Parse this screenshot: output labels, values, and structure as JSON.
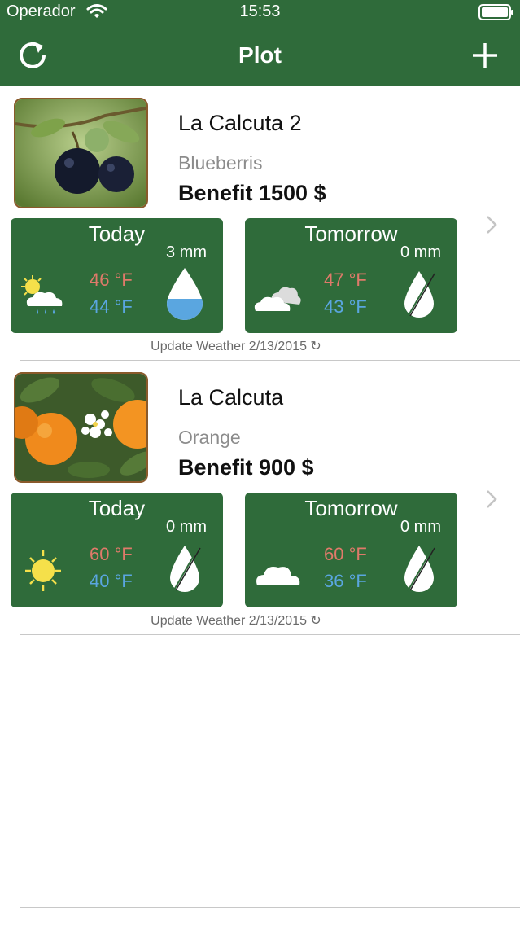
{
  "status_bar": {
    "carrier": "Operador",
    "time": "15:53"
  },
  "nav": {
    "title": "Plot",
    "left_icon": "refresh-icon",
    "right_icon": "plus-icon"
  },
  "colors": {
    "primary_green": "#2f6b3a",
    "temp_high": "#e07a6a",
    "temp_low": "#5aa6e0"
  },
  "plots": [
    {
      "name": "La Calcuta 2",
      "crop": "Blueberris",
      "benefit": "Benefit 1500 $",
      "photo": "blueberries-photo",
      "today": {
        "title": "Today",
        "rain": "3 mm",
        "high": "46 °F",
        "low": "44 °F",
        "condition": "sun-cloud-rain-icon",
        "drop": "water-drop-filled-icon"
      },
      "tomorrow": {
        "title": "Tomorrow",
        "rain": "0 mm",
        "high": "47 °F",
        "low": "43 °F",
        "condition": "cloudy-icon",
        "drop": "no-rain-drop-icon"
      },
      "update": "Update Weather 2/13/2015 ↻"
    },
    {
      "name": "La Calcuta",
      "crop": "Orange",
      "benefit": "Benefit 900 $",
      "photo": "oranges-photo",
      "today": {
        "title": "Today",
        "rain": "0 mm",
        "high": "60 °F",
        "low": "40 °F",
        "condition": "sunny-icon",
        "drop": "no-rain-drop-icon"
      },
      "tomorrow": {
        "title": "Tomorrow",
        "rain": "0 mm",
        "high": "60 °F",
        "low": "36 °F",
        "condition": "cloud-icon",
        "drop": "no-rain-drop-icon"
      },
      "update": "Update Weather 2/13/2015 ↻"
    }
  ]
}
